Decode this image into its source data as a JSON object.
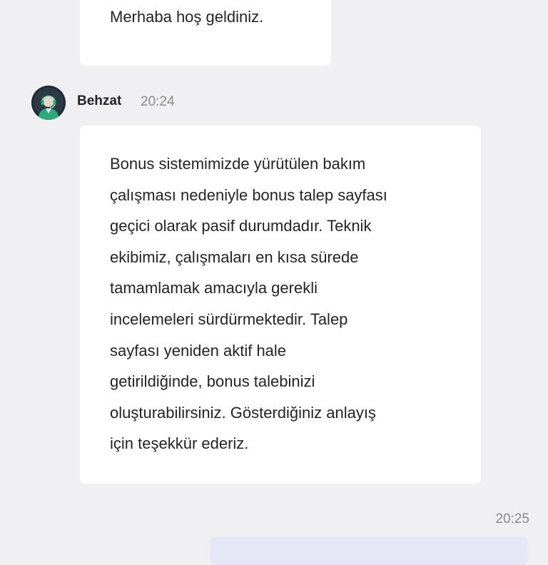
{
  "chat": {
    "previous_message": {
      "text": "Merhaba hoş geldiniz."
    },
    "message": {
      "sender": "Behzat",
      "time": "20:24",
      "avatar_icon": "avatar-headset-agent-icon",
      "lines": [
        "Bonus sistemimizde yürütülen bakım",
        "çalışması nedeniyle bonus talep sayfası",
        "geçici olarak pasif durumdadır. Teknik",
        "ekibimiz, çalışmaları en kısa sürede",
        "tamamlamak amacıyla gerekli",
        "incelemeleri sürdürmektedir. Talep",
        "sayfası yeniden aktif hale",
        "getirildiğinde, bonus talebinizi",
        "oluşturabilirsiniz. Gösterdiğiniz anlayış",
        "için teşekkür ederiz."
      ]
    },
    "outgoing_message": {
      "time": "20:25"
    },
    "colors": {
      "background": "#f0f0f3",
      "incoming_bubble": "#ffffff",
      "outgoing_bubble": "#e5e6f6",
      "avatar_ring": "#2eaa7a"
    }
  }
}
